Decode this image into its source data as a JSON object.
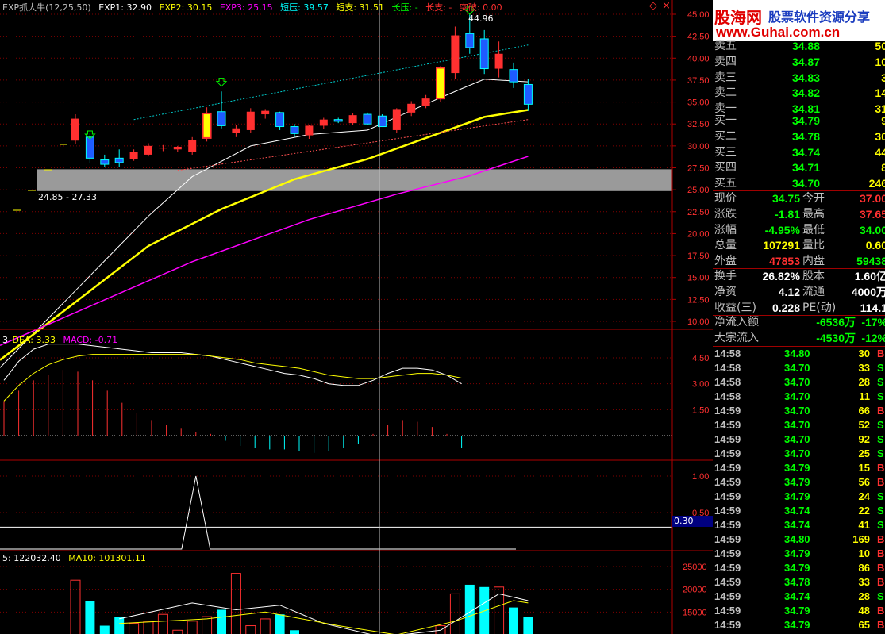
{
  "colors": {
    "up": "#ff3030",
    "down": "#00ffff",
    "green": "#00ff00",
    "yellow": "#ffff00",
    "white": "#ffffff",
    "magenta": "#ff00ff",
    "cyan": "#00ffff",
    "grid": "#800000"
  },
  "indicator": {
    "name": "EXP抓大牛(12,25,50)",
    "exp1": "EXP1: 32.90",
    "exp2": "EXP2: 30.15",
    "exp3": "EXP3: 25.15",
    "short_press": "短压: 39.57",
    "short_support": "短支: 31.51",
    "long_press": "长压: -",
    "long_support": "长支: -",
    "breakout": "突破: 0.00",
    "peak_label": "44.96",
    "range_label": "24.85 - 27.33"
  },
  "price_axis": [
    "45.00",
    "42.50",
    "40.00",
    "37.50",
    "35.00",
    "32.50",
    "30.00",
    "27.50",
    "25.00",
    "22.50",
    "20.00",
    "17.50",
    "15.00",
    "12.50",
    "10.00"
  ],
  "macd": {
    "dea": "DEA: 3.33",
    "macd": "MACD: -0.71",
    "prefix": "3",
    "axis": [
      "4.50",
      "3.00",
      "1.50"
    ]
  },
  "ind2": {
    "axis": [
      "1.00",
      "0.50"
    ],
    "current": "0.30"
  },
  "volume": {
    "line1": "5: 122032.40",
    "line2": "MA10: 101301.11",
    "axis": [
      "25000",
      "20000",
      "15000"
    ]
  },
  "logo": {
    "title": "股海网",
    "subtitle": "股票软件资源分享",
    "url": "www.Guhai.com.cn"
  },
  "asks": [
    {
      "label": "卖五",
      "price": "34.88",
      "vol": "50"
    },
    {
      "label": "卖四",
      "price": "34.87",
      "vol": "10"
    },
    {
      "label": "卖三",
      "price": "34.83",
      "vol": "3"
    },
    {
      "label": "卖二",
      "price": "34.82",
      "vol": "14"
    },
    {
      "label": "卖一",
      "price": "34.81",
      "vol": "31"
    }
  ],
  "bids": [
    {
      "label": "买一",
      "price": "34.79",
      "vol": "9"
    },
    {
      "label": "买二",
      "price": "34.78",
      "vol": "30"
    },
    {
      "label": "买三",
      "price": "34.74",
      "vol": "44"
    },
    {
      "label": "买四",
      "price": "34.71",
      "vol": "8"
    },
    {
      "label": "买五",
      "price": "34.70",
      "vol": "246"
    }
  ],
  "quote": [
    {
      "l1": "现价",
      "v1": "34.75",
      "l2": "今开",
      "v2": "37.00"
    },
    {
      "l1": "涨跌",
      "v1": "-1.81",
      "l2": "最高",
      "v2": "37.65"
    },
    {
      "l1": "涨幅",
      "v1": "-4.95%",
      "l2": "最低",
      "v2": "34.00"
    },
    {
      "l1": "总量",
      "v1": "107291",
      "l2": "量比",
      "v2": "0.60"
    },
    {
      "l1": "外盘",
      "v1": "47853",
      "l2": "内盘",
      "v2": "59438"
    }
  ],
  "fund": [
    {
      "l1": "换手",
      "v1": "26.82%",
      "l2": "股本",
      "v2": "1.60亿"
    },
    {
      "l1": "净资",
      "v1": "4.12",
      "l2": "流通",
      "v2": "4000万"
    },
    {
      "l1": "收益(三)",
      "v1": "0.228",
      "l2": "PE(动)",
      "v2": "114.1"
    }
  ],
  "flow": [
    {
      "label": "净流入额",
      "v1": "-6536万",
      "v2": "-17%"
    },
    {
      "label": "大宗流入",
      "v1": "-4530万",
      "v2": "-12%"
    }
  ],
  "ticks": [
    {
      "t": "14:58",
      "p": "34.80",
      "v": "30",
      "s": "B"
    },
    {
      "t": "14:58",
      "p": "34.70",
      "v": "33",
      "s": "S"
    },
    {
      "t": "14:58",
      "p": "34.70",
      "v": "28",
      "s": "S"
    },
    {
      "t": "14:58",
      "p": "34.70",
      "v": "11",
      "s": "S"
    },
    {
      "t": "14:59",
      "p": "34.70",
      "v": "66",
      "s": "B"
    },
    {
      "t": "14:59",
      "p": "34.70",
      "v": "52",
      "s": "S"
    },
    {
      "t": "14:59",
      "p": "34.70",
      "v": "92",
      "s": "S"
    },
    {
      "t": "14:59",
      "p": "34.70",
      "v": "25",
      "s": "S"
    },
    {
      "t": "14:59",
      "p": "34.79",
      "v": "15",
      "s": "B"
    },
    {
      "t": "14:59",
      "p": "34.79",
      "v": "56",
      "s": "B"
    },
    {
      "t": "14:59",
      "p": "34.79",
      "v": "24",
      "s": "S"
    },
    {
      "t": "14:59",
      "p": "34.74",
      "v": "22",
      "s": "S"
    },
    {
      "t": "14:59",
      "p": "34.74",
      "v": "41",
      "s": "S"
    },
    {
      "t": "14:59",
      "p": "34.80",
      "v": "169",
      "s": "B"
    },
    {
      "t": "14:59",
      "p": "34.79",
      "v": "10",
      "s": "B"
    },
    {
      "t": "14:59",
      "p": "34.79",
      "v": "86",
      "s": "B"
    },
    {
      "t": "14:59",
      "p": "34.78",
      "v": "33",
      "s": "B"
    },
    {
      "t": "14:59",
      "p": "34.74",
      "v": "28",
      "s": "S"
    },
    {
      "t": "14:59",
      "p": "34.79",
      "v": "48",
      "s": "B"
    },
    {
      "t": "14:59",
      "p": "34.79",
      "v": "65",
      "s": "B"
    }
  ],
  "chart_data": {
    "type": "candlestick",
    "ylim": [
      10,
      45
    ],
    "candles": [
      {
        "o": 30.6,
        "h": 33.6,
        "l": 30.2,
        "c": 33.1
      },
      {
        "o": 31.0,
        "h": 31.5,
        "l": 28.0,
        "c": 28.6
      },
      {
        "o": 28.4,
        "h": 29.0,
        "l": 27.6,
        "c": 27.9
      },
      {
        "o": 28.6,
        "h": 29.6,
        "l": 27.6,
        "c": 28.1
      },
      {
        "o": 28.5,
        "h": 29.6,
        "l": 28.3,
        "c": 29.3
      },
      {
        "o": 29.0,
        "h": 30.3,
        "l": 28.8,
        "c": 30.0
      },
      {
        "o": 29.7,
        "h": 30.1,
        "l": 29.4,
        "c": 29.8
      },
      {
        "o": 29.6,
        "h": 30.0,
        "l": 29.3,
        "c": 29.9
      },
      {
        "o": 29.3,
        "h": 31.0,
        "l": 29.0,
        "c": 30.7
      },
      {
        "o": 30.9,
        "h": 34.4,
        "l": 30.5,
        "c": 33.7
      },
      {
        "o": 33.9,
        "h": 36.2,
        "l": 32.0,
        "c": 32.3
      },
      {
        "o": 31.5,
        "h": 32.4,
        "l": 31.0,
        "c": 32.0
      },
      {
        "o": 31.8,
        "h": 34.3,
        "l": 31.5,
        "c": 33.9
      },
      {
        "o": 33.6,
        "h": 34.2,
        "l": 33.1,
        "c": 34.0
      },
      {
        "o": 33.8,
        "h": 33.9,
        "l": 31.8,
        "c": 32.2
      },
      {
        "o": 32.2,
        "h": 32.5,
        "l": 31.0,
        "c": 31.4
      },
      {
        "o": 31.2,
        "h": 32.4,
        "l": 30.8,
        "c": 32.3
      },
      {
        "o": 32.3,
        "h": 33.2,
        "l": 31.9,
        "c": 33.0
      },
      {
        "o": 33.0,
        "h": 33.2,
        "l": 32.6,
        "c": 32.8
      },
      {
        "o": 32.6,
        "h": 33.7,
        "l": 32.4,
        "c": 33.5
      },
      {
        "o": 33.6,
        "h": 33.8,
        "l": 32.4,
        "c": 32.5
      },
      {
        "o": 33.4,
        "h": 33.6,
        "l": 32.2,
        "c": 32.2
      },
      {
        "o": 31.8,
        "h": 34.3,
        "l": 31.5,
        "c": 34.2
      },
      {
        "o": 33.8,
        "h": 35.1,
        "l": 33.4,
        "c": 34.8
      },
      {
        "o": 34.6,
        "h": 35.8,
        "l": 34.3,
        "c": 35.4
      },
      {
        "o": 35.4,
        "h": 39.1,
        "l": 35.0,
        "c": 38.9
      },
      {
        "o": 38.3,
        "h": 43.6,
        "l": 37.6,
        "c": 42.6
      },
      {
        "o": 42.8,
        "h": 44.96,
        "l": 40.5,
        "c": 41.2
      },
      {
        "o": 42.2,
        "h": 43.2,
        "l": 38.2,
        "c": 38.8
      },
      {
        "o": 38.8,
        "h": 41.9,
        "l": 37.8,
        "c": 40.5
      },
      {
        "o": 38.7,
        "h": 39.5,
        "l": 36.6,
        "c": 37.3
      },
      {
        "o": 37.0,
        "h": 37.65,
        "l": 34.0,
        "c": 34.75
      }
    ],
    "ma_white": [
      {
        "i": 0,
        "v": 13.5
      },
      {
        "i": 5,
        "v": 22.0
      },
      {
        "i": 8,
        "v": 26.5
      },
      {
        "i": 12,
        "v": 30.0
      },
      {
        "i": 16,
        "v": 31.3
      },
      {
        "i": 20,
        "v": 31.8
      },
      {
        "i": 25,
        "v": 35.5
      },
      {
        "i": 28,
        "v": 37.6
      },
      {
        "i": 31,
        "v": 37.3
      }
    ],
    "ma_yellow": [
      {
        "i": 0,
        "v": 12.2
      },
      {
        "i": 5,
        "v": 18.6
      },
      {
        "i": 10,
        "v": 22.8
      },
      {
        "i": 15,
        "v": 26.2
      },
      {
        "i": 20,
        "v": 28.5
      },
      {
        "i": 25,
        "v": 31.5
      },
      {
        "i": 28,
        "v": 33.3
      },
      {
        "i": 31,
        "v": 34.1
      }
    ],
    "ma_magenta": [
      {
        "i": 0,
        "v": 11.0
      },
      {
        "i": 8,
        "v": 16.8
      },
      {
        "i": 16,
        "v": 21.6
      },
      {
        "i": 22,
        "v": 24.5
      },
      {
        "i": 27,
        "v": 26.6
      },
      {
        "i": 31,
        "v": 28.8
      }
    ],
    "resistance": [
      {
        "i": 4,
        "v": 33.0
      },
      {
        "i": 31,
        "v": 41.5
      }
    ],
    "support": [
      {
        "i": 7,
        "v": 27.2
      },
      {
        "i": 31,
        "v": 33.0
      }
    ],
    "band": [
      24.85,
      27.33
    ],
    "macd_hist": [
      2.0,
      2.6,
      3.2,
      3.5,
      3.8,
      3.7,
      3.2,
      2.6,
      1.9,
      1.3,
      0.9,
      0.6,
      0.4,
      0.2,
      0.1,
      -0.3,
      -0.6,
      -0.7,
      -0.8,
      -0.8,
      -0.9,
      -1.0,
      -0.9,
      -0.7,
      -0.5,
      0.1,
      0.6,
      0.9,
      0.8,
      0.5,
      0.1,
      -0.71
    ],
    "macd_dif": [
      3.2,
      4.3,
      5.0,
      5.3,
      5.3,
      5.3,
      5.2,
      5.1,
      5.0,
      4.9,
      4.8,
      4.8,
      4.8,
      4.7,
      4.6,
      4.4,
      4.2,
      4.0,
      3.8,
      3.6,
      3.5,
      3.3,
      3.0,
      2.9,
      2.9,
      3.2,
      3.6,
      3.9,
      3.9,
      3.8,
      3.5,
      3.0
    ],
    "macd_dea": [
      2.0,
      2.9,
      3.6,
      4.1,
      4.4,
      4.6,
      4.7,
      4.7,
      4.7,
      4.7,
      4.7,
      4.7,
      4.7,
      4.7,
      4.6,
      4.5,
      4.4,
      4.2,
      4.1,
      4.0,
      3.9,
      3.7,
      3.5,
      3.4,
      3.3,
      3.3,
      3.4,
      3.5,
      3.6,
      3.6,
      3.5,
      3.33
    ],
    "spike": [
      {
        "i": 12,
        "v": 0
      },
      {
        "i": 13,
        "v": 1.0
      },
      {
        "i": 14,
        "v": 0
      }
    ],
    "volumes": [
      22000,
      17500,
      12000,
      14000,
      12500,
      13000,
      14500,
      11000,
      13000,
      14000,
      15500,
      23500,
      12000,
      13500,
      14500,
      11000,
      9500,
      9000,
      9000,
      9500,
      8500,
      10000,
      8000,
      9000,
      8500,
      12000,
      19000,
      21000,
      20500,
      20500,
      16000,
      14000
    ],
    "vol_ma5": [
      {
        "i": 3,
        "v": 13500
      },
      {
        "i": 8,
        "v": 17000
      },
      {
        "i": 11,
        "v": 15500
      },
      {
        "i": 14,
        "v": 16500
      },
      {
        "i": 17,
        "v": 12500
      },
      {
        "i": 21,
        "v": 9500
      },
      {
        "i": 25,
        "v": 11000
      },
      {
        "i": 29,
        "v": 19000
      },
      {
        "i": 31,
        "v": 17500
      }
    ],
    "vol_ma10": [
      {
        "i": 3,
        "v": 12500
      },
      {
        "i": 9,
        "v": 13500
      },
      {
        "i": 13,
        "v": 15000
      },
      {
        "i": 18,
        "v": 12000
      },
      {
        "i": 22,
        "v": 10000
      },
      {
        "i": 26,
        "v": 13000
      },
      {
        "i": 30,
        "v": 17500
      },
      {
        "i": 31,
        "v": 17000
      }
    ]
  }
}
